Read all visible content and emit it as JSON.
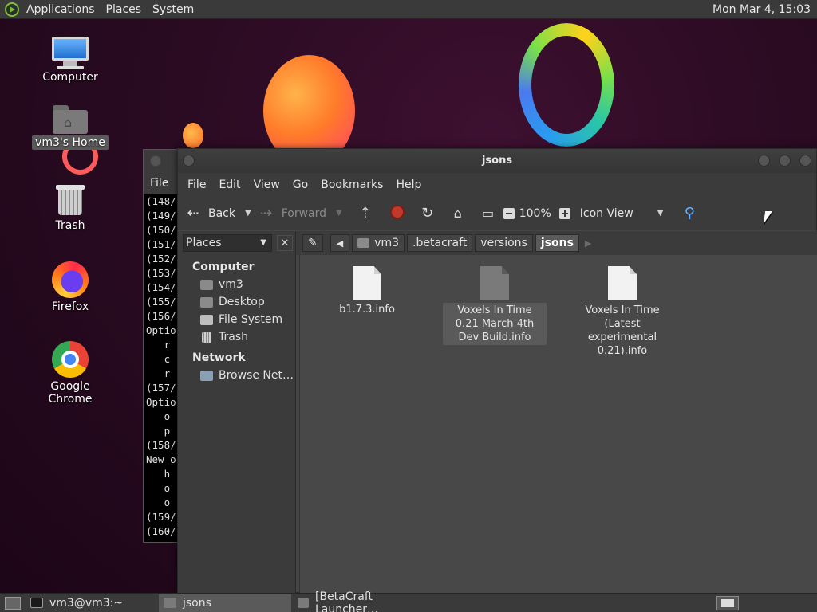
{
  "top_panel": {
    "menus": [
      "Applications",
      "Places",
      "System"
    ],
    "clock": "Mon Mar 4, 15:03"
  },
  "desktop_icons": [
    {
      "label": "Computer",
      "icon": "computer-icon"
    },
    {
      "label": "vm3's Home",
      "icon": "home-folder-icon",
      "selected": true
    },
    {
      "label": "Trash",
      "icon": "trash-icon"
    },
    {
      "label": "Firefox",
      "icon": "firefox-icon"
    },
    {
      "label": "Google Chrome",
      "icon": "chrome-icon"
    }
  ],
  "terminal": {
    "menu_label": "File",
    "lines": [
      "(148/",
      "(149/",
      "(150/",
      "(151/",
      "(152/",
      "(153/",
      "(154/",
      "(155/",
      "(156/",
      "Optio",
      "   r",
      "   c",
      "   r",
      "(157/",
      "Optio",
      "   o",
      "   p",
      "(158/",
      "New o",
      "   h",
      "   o",
      "   o",
      "(159/",
      "(160/"
    ]
  },
  "file_manager": {
    "title": "jsons",
    "menus": [
      "File",
      "Edit",
      "View",
      "Go",
      "Bookmarks",
      "Help"
    ],
    "toolbar": {
      "back_label": "Back",
      "forward_label": "Forward",
      "zoom": "100%",
      "view_mode": "Icon View"
    },
    "sidebar": {
      "selector_label": "Places",
      "sections": [
        {
          "title": "Computer",
          "items": [
            {
              "label": "vm3",
              "icon": "home-icon"
            },
            {
              "label": "Desktop",
              "icon": "desktop-icon"
            },
            {
              "label": "File System",
              "icon": "drive-icon"
            },
            {
              "label": "Trash",
              "icon": "trash-icon"
            }
          ]
        },
        {
          "title": "Network",
          "items": [
            {
              "label": "Browse Net…",
              "icon": "network-icon"
            }
          ]
        }
      ]
    },
    "path": [
      "vm3",
      ".betacraft",
      "versions",
      "jsons"
    ],
    "files": [
      {
        "name": "b1.7.3.info",
        "selected": false
      },
      {
        "name": "Voxels In Time 0.21 March 4th Dev Build.info",
        "selected": true
      },
      {
        "name": "Voxels In Time (Latest experimental 0.21).info",
        "selected": false
      }
    ]
  },
  "taskbar": {
    "tasks": [
      {
        "label": "vm3@vm3:~",
        "icon": "terminal-icon",
        "active": false
      },
      {
        "label": "jsons",
        "icon": "folder-icon",
        "active": true
      },
      {
        "label": "[BetaCraft Launcher…",
        "icon": "launcher-icon",
        "active": false
      }
    ]
  }
}
